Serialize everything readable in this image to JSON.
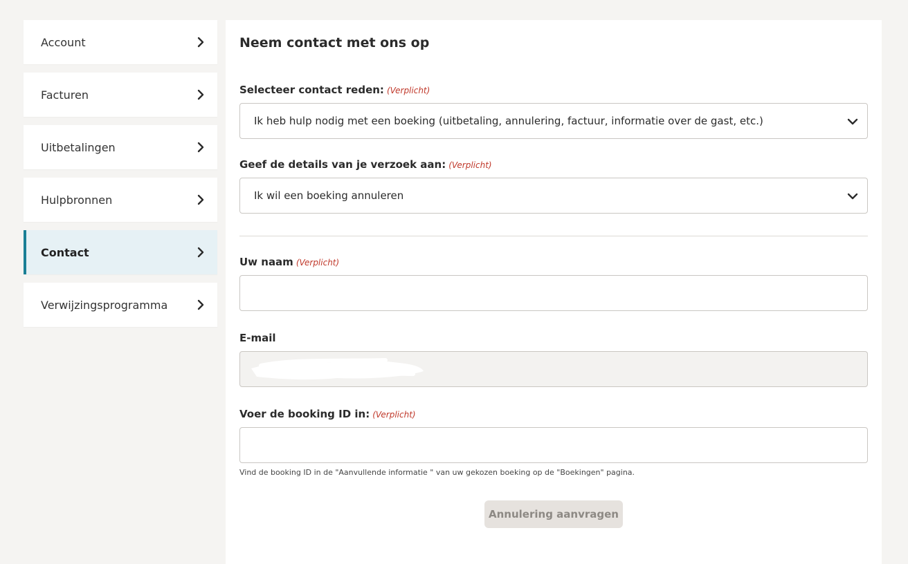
{
  "sidebar": {
    "items": [
      {
        "label": "Account"
      },
      {
        "label": "Facturen"
      },
      {
        "label": "Uitbetalingen"
      },
      {
        "label": "Hulpbronnen"
      },
      {
        "label": "Contact"
      },
      {
        "label": "Verwijzingsprogramma"
      }
    ],
    "active_index": 4,
    "accent_color": "#1a7f95"
  },
  "form": {
    "title": "Neem contact met ons op",
    "required_text": "(Verplicht)",
    "reason": {
      "label": "Selecteer contact reden:",
      "selected": "Ik heb hulp nodig met een boeking (uitbetaling, annulering, factuur, informatie over de gast, etc.)"
    },
    "details": {
      "label": "Geef de details van je verzoek aan:",
      "selected": "Ik wil een boeking annuleren"
    },
    "name": {
      "label": "Uw naam",
      "value": ""
    },
    "email": {
      "label": "E-mail"
    },
    "booking_id": {
      "label": "Voer de booking ID in:",
      "value": "",
      "hint": "Vind de booking ID in de \"Aanvullende informatie \" van uw gekozen boeking op de \"Boekingen\" pagina."
    },
    "submit_label": "Annulering aanvragen"
  }
}
